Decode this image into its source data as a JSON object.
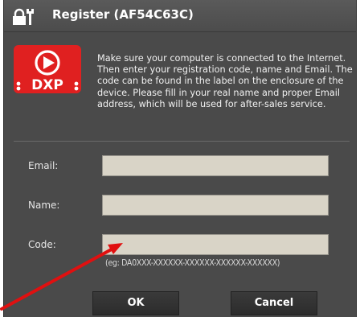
{
  "window": {
    "title": "Register (AF54C63C)",
    "icon": "lock-tools-icon"
  },
  "logo": {
    "text": "DXP",
    "icon": "play-icon",
    "color": "#e02020"
  },
  "info_text": "Make sure your computer is connected to the Internet. Then enter your registration code, name and Email. The code can be found in the label on the enclosure of the device. Please fill in your real name and proper Email address, which will be used for after-sales service.",
  "form": {
    "email_label": "Email:",
    "email_value": "",
    "name_label": "Name:",
    "name_value": "",
    "code_label": "Code:",
    "code_value": "",
    "code_hint": "(eg: DA0XXX-XXXXXX-XXXXXX-XXXXXX-XXXXXX)",
    "input_color": "#d9d4c7"
  },
  "buttons": {
    "ok_label": "OK",
    "cancel_label": "Cancel"
  },
  "annotation": {
    "arrow_color": "#e01010",
    "points_to": "code-input"
  }
}
